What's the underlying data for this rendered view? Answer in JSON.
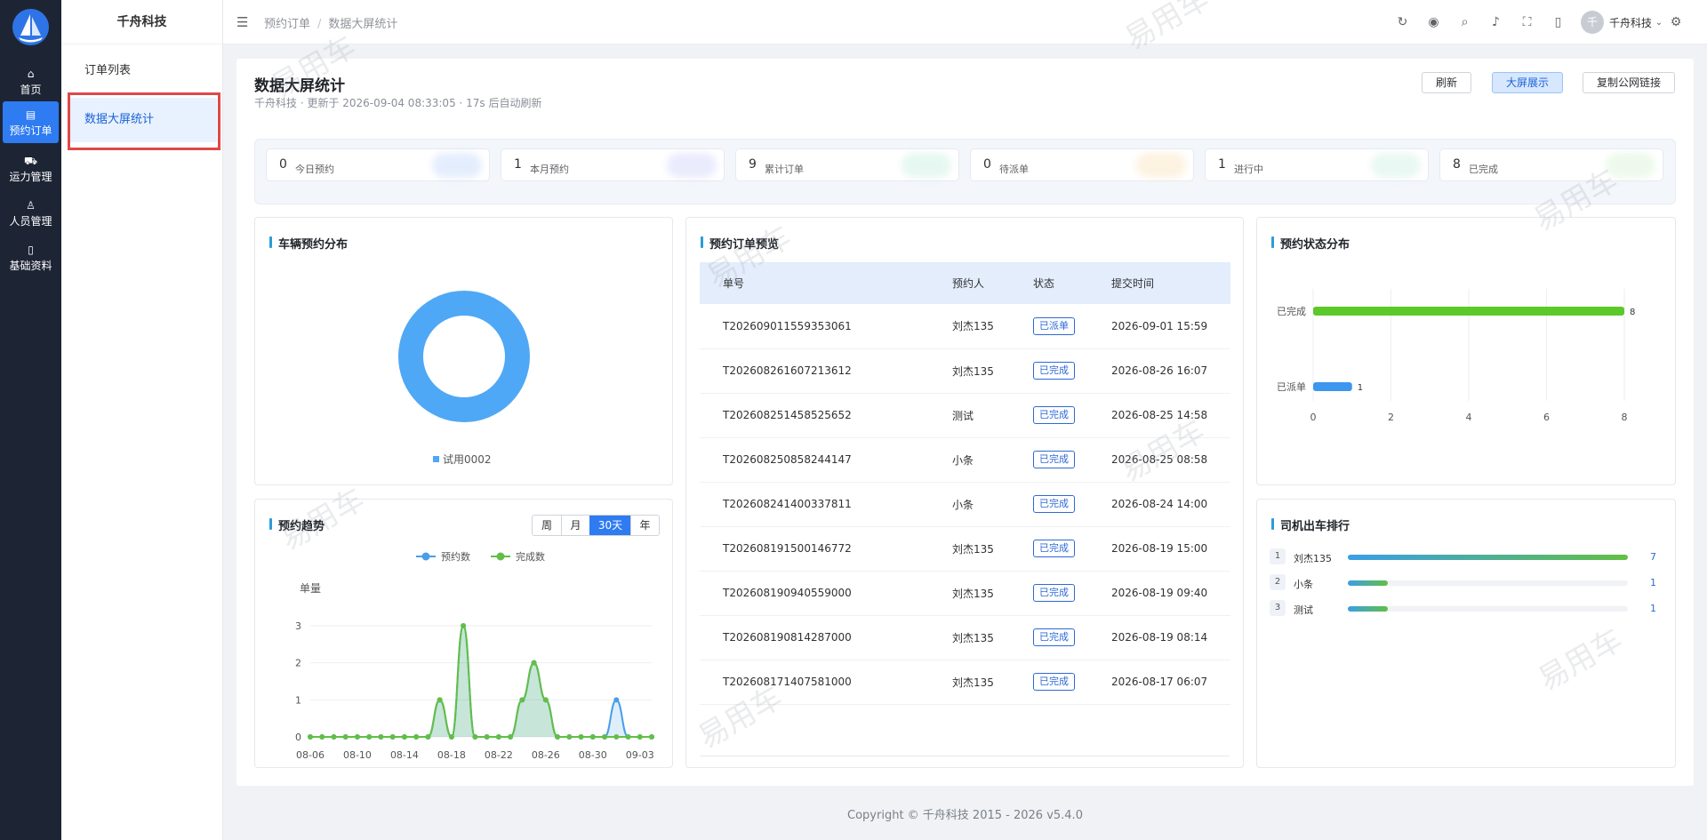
{
  "nav": {
    "items": [
      {
        "label": "首页"
      },
      {
        "label": "预约订单"
      },
      {
        "label": "运力管理"
      },
      {
        "label": "人员管理"
      },
      {
        "label": "基础资料"
      }
    ]
  },
  "sub": {
    "title": "千舟科技",
    "items": [
      {
        "label": "订单列表"
      },
      {
        "label": "数据大屏统计"
      }
    ]
  },
  "topbar": {
    "breadcrumb": [
      "预约订单",
      "数据大屏统计"
    ],
    "breadcrumb_sep": "/",
    "avatar": "千",
    "user": "千舟科技"
  },
  "page": {
    "title": "数据大屏统计",
    "subtitle": "千舟科技 · 更新于 2026-09-04 08:33:05 · 17s 后自动刷新",
    "buttons": {
      "refresh": "刷新",
      "bigscreen": "大屏展示",
      "copy": "复制公网链接"
    }
  },
  "stats": [
    {
      "value": "0",
      "label": "今日预约",
      "color": "#cfe0fb"
    },
    {
      "value": "1",
      "label": "本月预约",
      "color": "#d9dcfb"
    },
    {
      "value": "9",
      "label": "累计订单",
      "color": "#d3f2e6"
    },
    {
      "value": "0",
      "label": "待派单",
      "color": "#fbe8c8"
    },
    {
      "value": "1",
      "label": "进行中",
      "color": "#d8f3e8"
    },
    {
      "value": "8",
      "label": "已完成",
      "color": "#dff5dc"
    }
  ],
  "vehicle_card": {
    "title": "车辆预约分布",
    "chart_data": {
      "type": "pie",
      "categories": [
        "试用0002"
      ],
      "values": [
        1
      ],
      "colors": [
        "#4fa8f5"
      ]
    }
  },
  "trend_card": {
    "title": "预约趋势",
    "ranges": [
      "周",
      "月",
      "30天",
      "年"
    ],
    "active_range": "30天",
    "chart_data": {
      "type": "area",
      "ylabel": "单量",
      "ylim": [
        0,
        3
      ],
      "yticks": [
        "0",
        "1",
        "2",
        "3"
      ],
      "x": [
        "08-06",
        "08-07",
        "08-08",
        "08-09",
        "08-10",
        "08-11",
        "08-12",
        "08-13",
        "08-14",
        "08-15",
        "08-16",
        "08-17",
        "08-18",
        "08-19",
        "08-20",
        "08-21",
        "08-22",
        "08-23",
        "08-24",
        "08-25",
        "08-26",
        "08-27",
        "08-28",
        "08-29",
        "08-30",
        "08-31",
        "09-01",
        "09-02",
        "09-03",
        "09-04"
      ],
      "xtick_labels": [
        "08-06",
        "08-10",
        "08-14",
        "08-18",
        "08-22",
        "08-26",
        "08-30",
        "09-03"
      ],
      "series": [
        {
          "name": "预约数",
          "color": "#4a9ee8",
          "values": [
            0,
            0,
            0,
            0,
            0,
            0,
            0,
            0,
            0,
            0,
            0,
            1,
            0,
            3,
            0,
            0,
            0,
            0,
            1,
            2,
            1,
            0,
            0,
            0,
            0,
            0,
            1,
            0,
            0,
            0
          ]
        },
        {
          "name": "完成数",
          "color": "#62bf45",
          "values": [
            0,
            0,
            0,
            0,
            0,
            0,
            0,
            0,
            0,
            0,
            0,
            1,
            0,
            3,
            0,
            0,
            0,
            0,
            1,
            2,
            1,
            0,
            0,
            0,
            0,
            0,
            0,
            0,
            0,
            0
          ]
        }
      ]
    }
  },
  "orders_card": {
    "title": "预约订单预览",
    "columns": [
      "单号",
      "预约人",
      "状态",
      "提交时间"
    ],
    "rows": [
      [
        "T202609011559353061",
        "刘杰135",
        "已派单",
        "2026-09-01 15:59"
      ],
      [
        "T202608261607213612",
        "刘杰135",
        "已完成",
        "2026-08-26 16:07"
      ],
      [
        "T202608251458525652",
        "测试",
        "已完成",
        "2026-08-25 14:58"
      ],
      [
        "T202608250858244147",
        "小条",
        "已完成",
        "2026-08-25 08:58"
      ],
      [
        "T202608241400337811",
        "小条",
        "已完成",
        "2026-08-24 14:00"
      ],
      [
        "T202608191500146772",
        "刘杰135",
        "已完成",
        "2026-08-19 15:00"
      ],
      [
        "T202608190940559000",
        "刘杰135",
        "已完成",
        "2026-08-19 09:40"
      ],
      [
        "T202608190814287000",
        "刘杰135",
        "已完成",
        "2026-08-19 08:14"
      ],
      [
        "T202608171407581000",
        "刘杰135",
        "已完成",
        "2026-08-17 06:07"
      ]
    ]
  },
  "status_card": {
    "title": "预约状态分布",
    "chart_data": {
      "type": "bar",
      "orientation": "horizontal",
      "categories": [
        "已完成",
        "已派单"
      ],
      "values": [
        8,
        1
      ],
      "colors": [
        "#5cc82a",
        "#3d97ef"
      ],
      "xlim": [
        0,
        8
      ],
      "xticks": [
        "0",
        "2",
        "4",
        "6",
        "8"
      ]
    }
  },
  "rank_card": {
    "title": "司机出车排行",
    "items": [
      {
        "rank": "1",
        "name": "刘杰135",
        "value": "7",
        "fraction": 1.0
      },
      {
        "rank": "2",
        "name": "小条",
        "value": "1",
        "fraction": 0.143
      },
      {
        "rank": "3",
        "name": "测试",
        "value": "1",
        "fraction": 0.143
      }
    ]
  },
  "footer": "Copyright © 千舟科技 2015 - 2026 v5.4.0",
  "watermark": "易用车"
}
